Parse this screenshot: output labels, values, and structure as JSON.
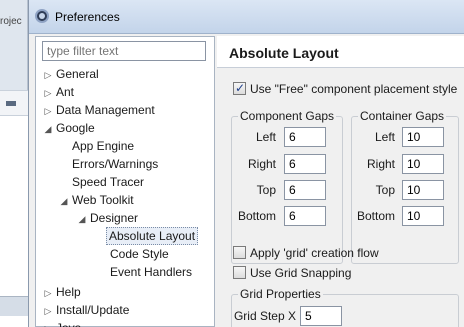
{
  "background": {
    "project_tab_text": "rojec"
  },
  "window": {
    "title": "Preferences"
  },
  "tree": {
    "filter_placeholder": "type filter text",
    "items": [
      {
        "label": "General",
        "arrow": "▷",
        "indent": 0
      },
      {
        "label": "Ant",
        "arrow": "▷",
        "indent": 0
      },
      {
        "label": "Data Management",
        "arrow": "▷",
        "indent": 0
      },
      {
        "label": "Google",
        "arrow": "◢",
        "indent": 0
      },
      {
        "label": "App Engine",
        "arrow": "",
        "indent": 1
      },
      {
        "label": "Errors/Warnings",
        "arrow": "",
        "indent": 1
      },
      {
        "label": "Speed Tracer",
        "arrow": "",
        "indent": 1
      },
      {
        "label": "Web Toolkit",
        "arrow": "◢",
        "indent": 1
      },
      {
        "label": "Designer",
        "arrow": "◢",
        "indent": 2
      },
      {
        "label": "Absolute Layout",
        "arrow": "",
        "indent": 3,
        "selected": true
      },
      {
        "label": "Code Style",
        "arrow": "",
        "indent": 3
      },
      {
        "label": "Event Handlers",
        "arrow": "",
        "indent": 3
      },
      {
        "label": "Help",
        "arrow": "▷",
        "indent": 0
      },
      {
        "label": "Install/Update",
        "arrow": "▷",
        "indent": 0
      },
      {
        "label": "Java",
        "arrow": "▷",
        "indent": 0
      }
    ]
  },
  "page": {
    "title": "Absolute Layout",
    "free_placement": {
      "label": "Use \"Free\" component placement style",
      "checked": true
    },
    "component_gaps": {
      "title": "Component Gaps",
      "left_label": "Left",
      "left_value": "6",
      "right_label": "Right",
      "right_value": "6",
      "top_label": "Top",
      "top_value": "6",
      "bottom_label": "Bottom",
      "bottom_value": "6"
    },
    "container_gaps": {
      "title": "Container Gaps",
      "left_label": "Left",
      "left_value": "10",
      "right_label": "Right",
      "right_value": "10",
      "top_label": "Top",
      "top_value": "10",
      "bottom_label": "Bottom",
      "bottom_value": "10"
    },
    "grid_flow": {
      "label": "Apply 'grid' creation flow",
      "checked": false
    },
    "grid_snapping": {
      "label": "Use Grid Snapping",
      "checked": false
    },
    "grid_properties": {
      "title": "Grid Properties",
      "step_x_label": "Grid Step X",
      "step_x_value": "5"
    }
  }
}
